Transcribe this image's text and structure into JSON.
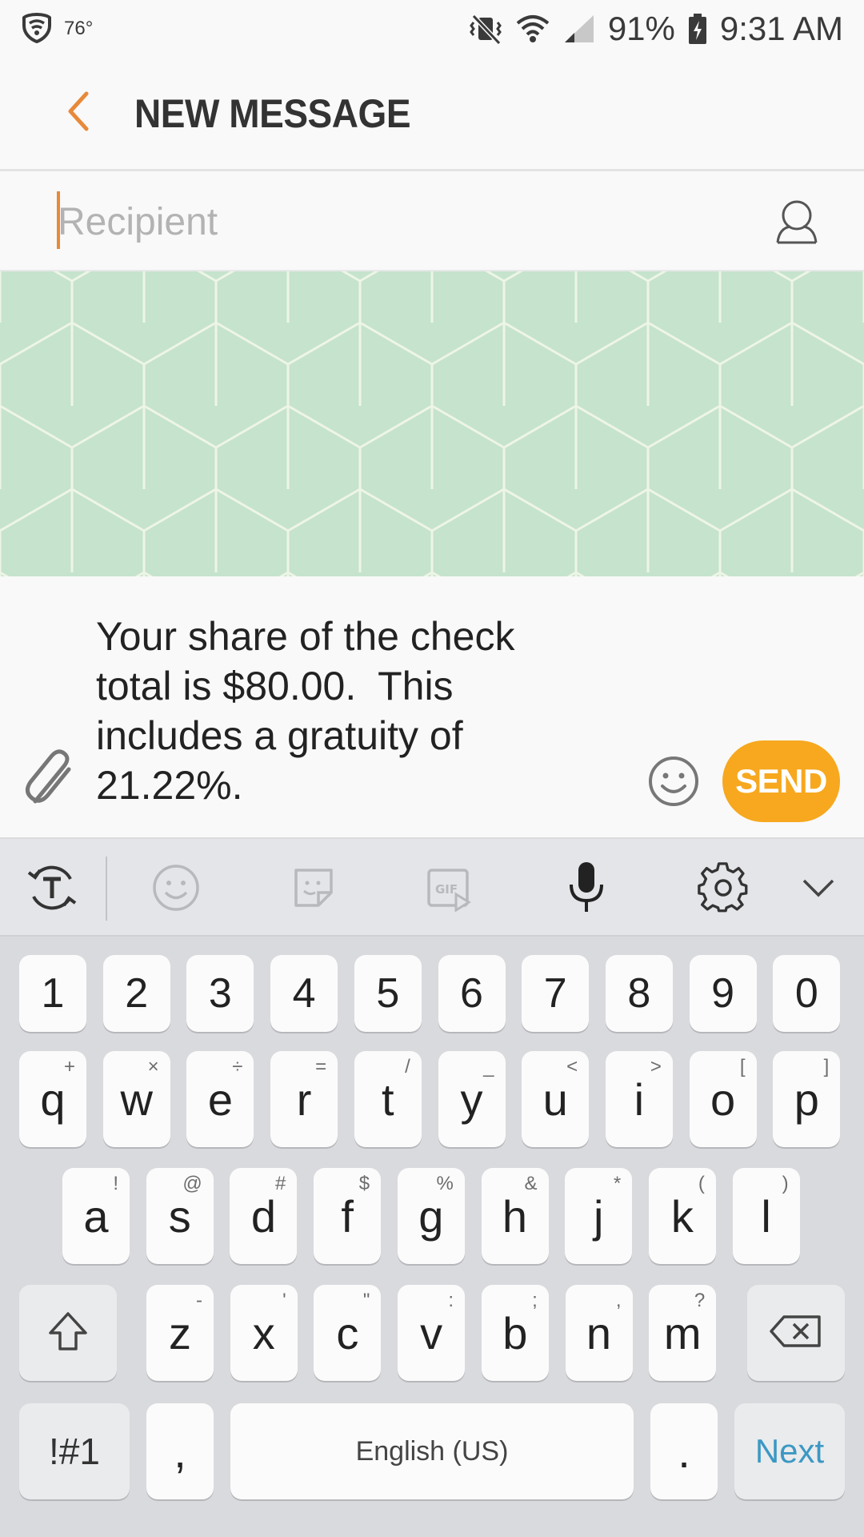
{
  "status_bar": {
    "temperature": "76°",
    "battery": "91%",
    "time": "9:31 AM"
  },
  "header": {
    "title": "NEW MESSAGE"
  },
  "recipient": {
    "placeholder": "Recipient",
    "value": ""
  },
  "compose": {
    "message": "Your share of the check total is $80.00.  This includes a gratuity of 21.22%.",
    "send_label": "SEND"
  },
  "keyboard": {
    "toolbar": [
      "text-mode-icon",
      "emoji-icon",
      "sticker-icon",
      "gif-icon",
      "microphone-icon",
      "settings-gear-icon",
      "collapse-chevron-icon"
    ],
    "number_row": [
      "1",
      "2",
      "3",
      "4",
      "5",
      "6",
      "7",
      "8",
      "9",
      "0"
    ],
    "row1": [
      {
        "key": "q",
        "alt": "+"
      },
      {
        "key": "w",
        "alt": "×"
      },
      {
        "key": "e",
        "alt": "÷"
      },
      {
        "key": "r",
        "alt": "="
      },
      {
        "key": "t",
        "alt": "/"
      },
      {
        "key": "y",
        "alt": "_"
      },
      {
        "key": "u",
        "alt": "<"
      },
      {
        "key": "i",
        "alt": ">"
      },
      {
        "key": "o",
        "alt": "["
      },
      {
        "key": "p",
        "alt": "]"
      }
    ],
    "row2": [
      {
        "key": "a",
        "alt": "!"
      },
      {
        "key": "s",
        "alt": "@"
      },
      {
        "key": "d",
        "alt": "#"
      },
      {
        "key": "f",
        "alt": "$"
      },
      {
        "key": "g",
        "alt": "%"
      },
      {
        "key": "h",
        "alt": "&"
      },
      {
        "key": "j",
        "alt": "*"
      },
      {
        "key": "k",
        "alt": "("
      },
      {
        "key": "l",
        "alt": ")"
      }
    ],
    "row3": [
      {
        "key": "z",
        "alt": "-"
      },
      {
        "key": "x",
        "alt": "'"
      },
      {
        "key": "c",
        "alt": "\""
      },
      {
        "key": "v",
        "alt": ":"
      },
      {
        "key": "b",
        "alt": ";"
      },
      {
        "key": "n",
        "alt": ","
      },
      {
        "key": "m",
        "alt": "?"
      }
    ],
    "bottom": {
      "symbols": "!#1",
      "comma": ",",
      "space": "English (US)",
      "period": ".",
      "action": "Next"
    }
  },
  "colors": {
    "accent": "#e8893a",
    "send": "#f7a81f",
    "pattern_bg": "#c5e3cd",
    "next": "#3c98c4"
  }
}
